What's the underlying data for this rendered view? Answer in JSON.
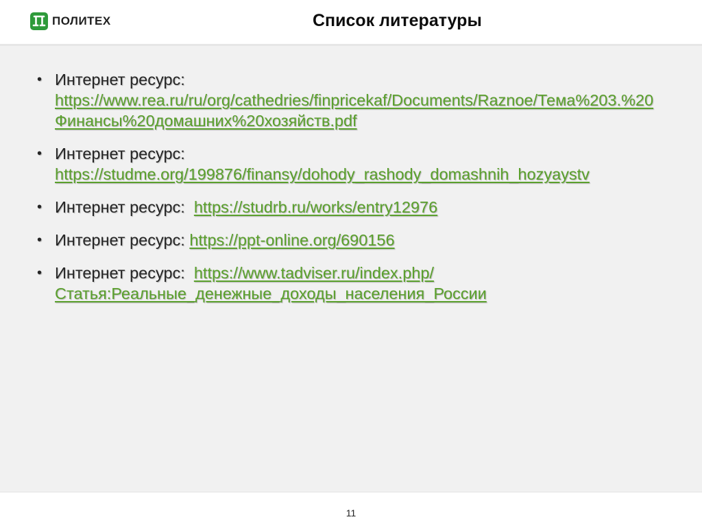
{
  "header": {
    "logo_text": "ПОЛИТЕХ",
    "title": "Список литературы"
  },
  "references": [
    {
      "label": "Интернет ресурс:",
      "link": "https://www.rea.ru/ru/org/cathedries/finpricekaf/Documents/Raznoe/Тема%203.%20Финансы%20домашних%20хозяйств.pdf"
    },
    {
      "label": "Интернет ресурс:",
      "link": "https://studme.org/199876/finansy/dohody_rashody_domashnih_hozyaystv"
    },
    {
      "label": "Интернет ресурс:  ",
      "link": "https://studrb.ru/works/entry12976"
    },
    {
      "label": "Интернет ресурс: ",
      "link": "https://ppt-online.org/690156"
    },
    {
      "label": "Интернет ресурс:  ",
      "link": "https://www.tadviser.ru/index.php/",
      "link2": "Статья:Реальные_денежные_доходы_населения_России"
    }
  ],
  "footer": {
    "page_number": "11"
  },
  "colors": {
    "link": "#5aa02c",
    "logo": "#2e9a3a",
    "content_bg": "#f1f1f1"
  }
}
